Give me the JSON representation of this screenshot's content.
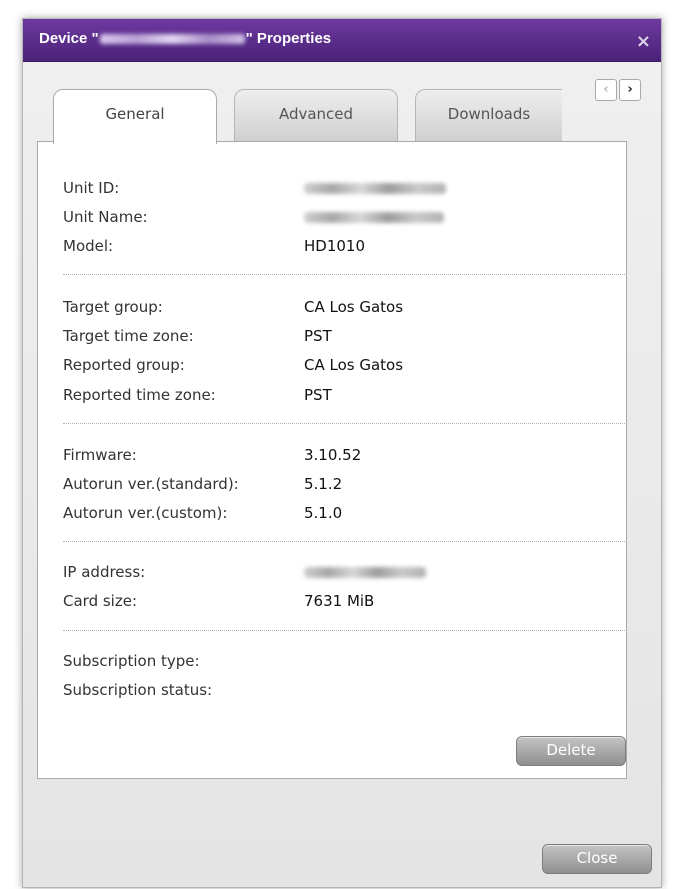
{
  "dialog": {
    "title_prefix": "Device \"",
    "title_suffix": "\" Properties",
    "close_icon": "×"
  },
  "tabs": [
    {
      "label": "General",
      "active": true
    },
    {
      "label": "Advanced",
      "active": false
    },
    {
      "label": "Downloads",
      "active": false
    }
  ],
  "tab_nav": {
    "prev": "‹",
    "next": "›"
  },
  "sections": {
    "unit": [
      {
        "label": "Unit ID:",
        "value": ""
      },
      {
        "label": "Unit Name:",
        "value": ""
      },
      {
        "label": "Model:",
        "value": "HD1010"
      }
    ],
    "group": [
      {
        "label": "Target group:",
        "value": "CA Los Gatos"
      },
      {
        "label": "Target time zone:",
        "value": "PST"
      },
      {
        "label": "Reported group:",
        "value": "CA Los Gatos"
      },
      {
        "label": "Reported time zone:",
        "value": "PST"
      }
    ],
    "software": [
      {
        "label": "Firmware:",
        "value": "3.10.52"
      },
      {
        "label": "Autorun ver.(standard):",
        "value": "5.1.2"
      },
      {
        "label": "Autorun ver.(custom):",
        "value": "5.1.0"
      }
    ],
    "network": [
      {
        "label": "IP address:",
        "value": ""
      },
      {
        "label": "Card size:",
        "value": "7631 MiB"
      }
    ],
    "subscription": [
      {
        "label": "Subscription type:",
        "value": ""
      },
      {
        "label": "Subscription status:",
        "value": ""
      }
    ]
  },
  "buttons": {
    "delete": "Delete",
    "close": "Close"
  },
  "colors": {
    "titlebar": "#5a2d8a",
    "button": "#a8a8a8"
  }
}
